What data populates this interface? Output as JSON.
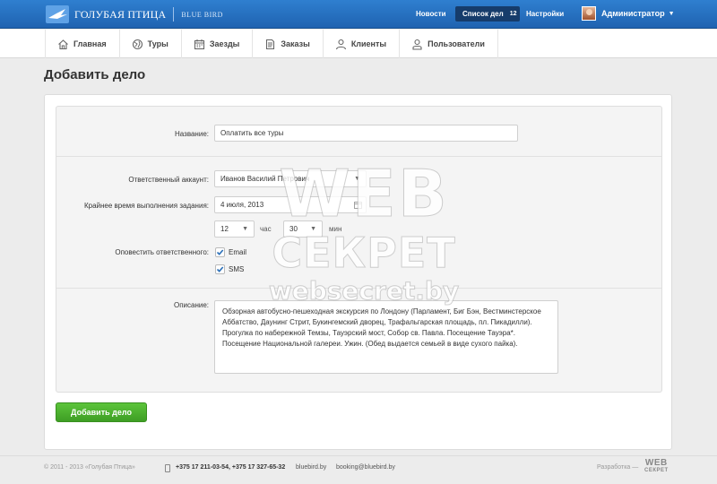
{
  "header": {
    "logo_name": "ГОЛУБАЯ ПТИЦА",
    "logo_sub": "BLUE BIRD",
    "news_label": "Новости",
    "tasks_label": "Список дел",
    "tasks_count": "12",
    "settings_label": "Настройки",
    "user_name": "Администратор",
    "caret": "▼"
  },
  "nav": {
    "items": [
      {
        "label": "Главная",
        "icon": "home-icon"
      },
      {
        "label": "Туры",
        "icon": "tour-icon"
      },
      {
        "label": "Заезды",
        "icon": "calendar-icon"
      },
      {
        "label": "Заказы",
        "icon": "document-icon"
      },
      {
        "label": "Клиенты",
        "icon": "client-icon"
      },
      {
        "label": "Пользователи",
        "icon": "users-icon"
      }
    ]
  },
  "page": {
    "title": "Добавить дело"
  },
  "form": {
    "name_label": "Название:",
    "name_value": "Оплатить все туры",
    "account_label": "Ответственный аккаунт:",
    "account_value": "Иванов Василий Петрович",
    "deadline_label": "Крайнее время выполнения задания:",
    "deadline_value": "4 июля, 2013",
    "hour_value": "12",
    "hour_label": "час",
    "minute_value": "30",
    "minute_label": "мин",
    "notify_label": "Оповестить ответственного:",
    "email_label": "Email",
    "email_checked": true,
    "sms_label": "SMS",
    "sms_checked": true,
    "description_label": "Описание:",
    "description_value": "Обзорная автобусно-пешеходная экскурсия по Лондону (Парламент, Биг Бэн, Вестминстерское Аббатство, Даунинг Стрит, Букингемский дворец, Трафальгарская площадь, пл. Пикадилли). Прогулка по набережной Темзы, Тауэрский мост, Собор св. Павла. Посещение Тауэра*. Посещение  Национальной галереи. Ужин. (Обед выдается семьей в виде сухого пайка).",
    "submit_label": "Добавить дело"
  },
  "watermark": {
    "line1": "WEB",
    "line2": "СЕКРЕТ",
    "line3": "websecret.by"
  },
  "footer": {
    "copyright": "© 2011 - 2013 «Голубая Птица»",
    "phones": "+375 17 211-03-54, +375 17 327-65-32",
    "site": "bluebird.by",
    "email": "booking@bluebird.by",
    "dev_label": "Разработка —",
    "dev_logo_top": "WEB",
    "dev_logo_bottom": "СЕКРЕТ"
  },
  "colors": {
    "header_blue": "#1f63b0",
    "tasks_pill": "#163c6b",
    "submit_green": "#4bb02f",
    "checkbox_blue": "#2b6fb8"
  }
}
